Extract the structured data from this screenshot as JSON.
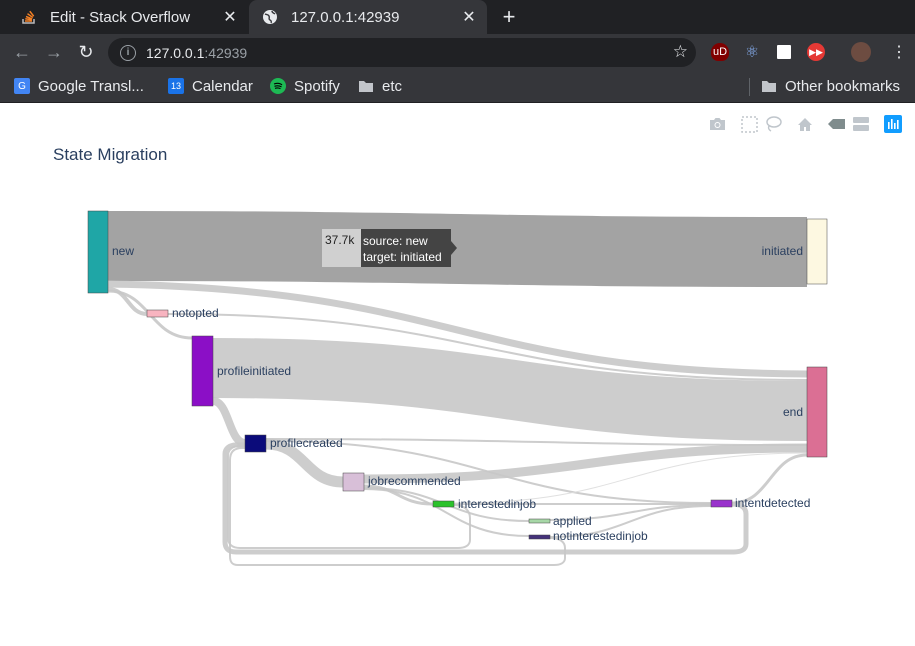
{
  "browser": {
    "tabs": [
      {
        "title": "Edit - Stack Overflow",
        "icon": "stackoverflow-icon",
        "active": false
      },
      {
        "title": "127.0.0.1:42939",
        "icon": "globe-icon",
        "active": true
      }
    ],
    "url_host": "127.0.0.1",
    "url_port": ":42939",
    "bookmarks": [
      {
        "label": "Google Transl...",
        "icon": "google-translate-icon"
      },
      {
        "label": "Calendar",
        "icon": "calendar-icon",
        "badge": "13"
      },
      {
        "label": "Spotify",
        "icon": "spotify-icon"
      },
      {
        "label": "etc",
        "icon": "folder-icon"
      }
    ],
    "other_bookmarks": "Other bookmarks",
    "extension_ublock": "uD"
  },
  "plot": {
    "title": "State Migration",
    "modebar": [
      "camera-icon",
      "box-select-icon",
      "lasso-icon",
      "home-icon",
      "hover-closest-icon",
      "hover-compare-icon",
      "plotly-logo-icon"
    ],
    "tooltip": {
      "value": "37.7k",
      "source_line": "source: new",
      "target_line": "target: initiated"
    },
    "nodes": [
      {
        "label": "new",
        "color": "#1fa6a6"
      },
      {
        "label": "initiated",
        "color": "#fdf8e1"
      },
      {
        "label": "notopted",
        "color": "#f8b4c0"
      },
      {
        "label": "profileinitiated",
        "color": "#8b0fc6"
      },
      {
        "label": "end",
        "color": "#db6f94"
      },
      {
        "label": "profilecreated",
        "color": "#0b0b7a"
      },
      {
        "label": "jobrecommended",
        "color": "#d8bfd8"
      },
      {
        "label": "interestedinjob",
        "color": "#2bc22b"
      },
      {
        "label": "applied",
        "color": "#a7d7a7"
      },
      {
        "label": "notinterestedinjob",
        "color": "#45327a"
      },
      {
        "label": "intentdetected",
        "color": "#9932cc"
      }
    ]
  },
  "colors": {
    "link": "#c8c8c8",
    "link_highlight": "#999999",
    "title": "#2a3f5f",
    "plotly_accent": "#119dff"
  }
}
